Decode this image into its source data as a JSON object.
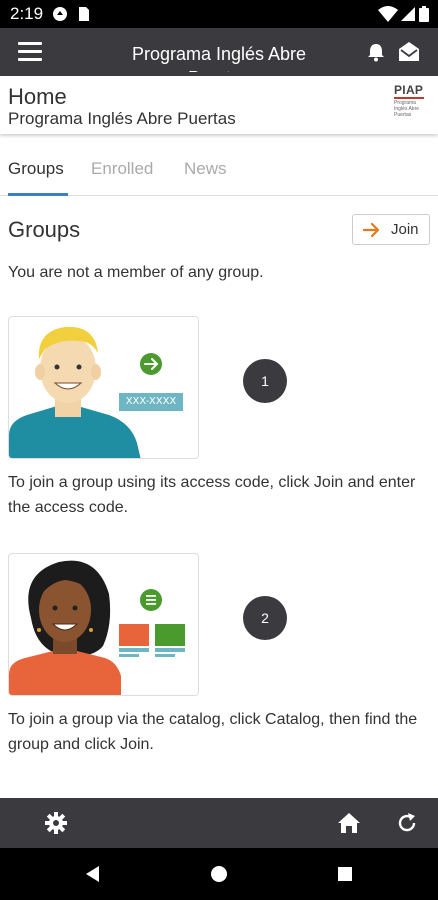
{
  "status_bar": {
    "time": "2:19"
  },
  "app_bar": {
    "title": "Programa Inglés Abre Puertas"
  },
  "header": {
    "title": "Home",
    "subtitle": "Programa Inglés Abre Puertas",
    "logo": {
      "text": "PIAP",
      "tagline": "Programa Inglés Abre Puertas"
    }
  },
  "tabs": [
    {
      "label": "Groups",
      "active": true
    },
    {
      "label": "Enrolled",
      "active": false
    },
    {
      "label": "News",
      "active": false
    }
  ],
  "groups": {
    "title": "Groups",
    "join_label": "Join",
    "empty_message": "You are not a member of any group.",
    "steps": [
      {
        "number": "1",
        "code_example": "XXX-XXXX",
        "text": "To join a group using its access code, click Join and enter the access code."
      },
      {
        "number": "2",
        "text": "To join a group via the catalog, click Catalog, then find the group and click Join."
      }
    ]
  },
  "colors": {
    "app_bar": "#3b3a3f",
    "accent": "#3b7fc4",
    "join_arrow": "#e07b1f",
    "green": "#4a9a2e"
  },
  "icons": {
    "app_bar": [
      "menu-icon",
      "bell-icon",
      "mail-icon"
    ],
    "bottom_bar": [
      "gear-icon",
      "home-icon",
      "refresh-icon"
    ],
    "nav": [
      "back-icon",
      "home-circle-icon",
      "recents-icon"
    ]
  }
}
